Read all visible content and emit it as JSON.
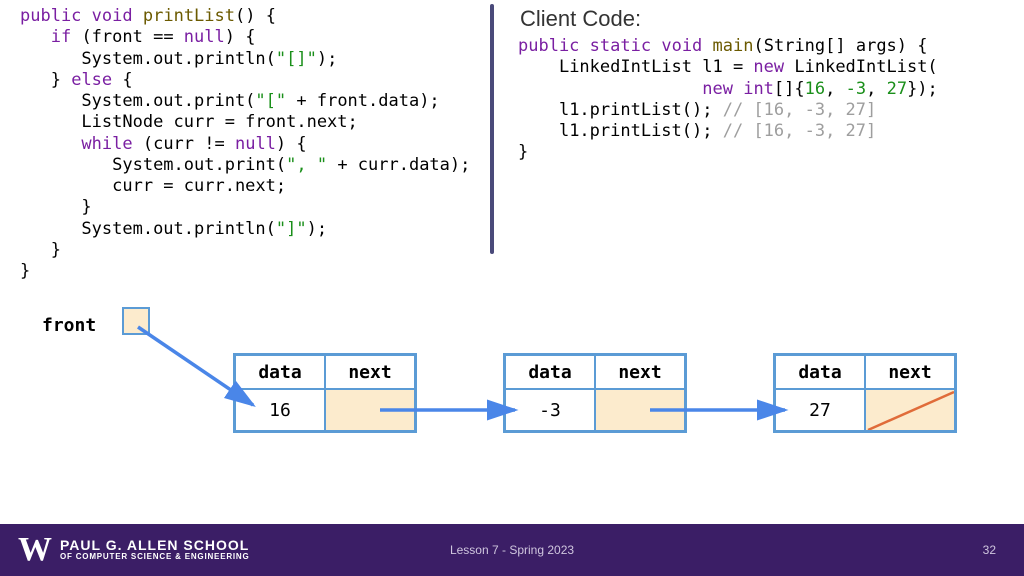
{
  "left_code": {
    "l1a": "public",
    "l1b": "void",
    "l1c": "printList",
    "l1d": "() {",
    "l2a": "if",
    "l2b": " (front == ",
    "l2c": "null",
    "l2d": ") {",
    "l3a": "System.out.println(",
    "l3b": "\"[]\"",
    "l3c": ");",
    "l4a": "} ",
    "l4b": "else",
    "l4c": " {",
    "l5a": "System.out.print(",
    "l5b": "\"[\"",
    "l5c": " + front.data);",
    "l6": "ListNode curr = front.next;",
    "l7a": "while",
    "l7b": " (curr != ",
    "l7c": "null",
    "l7d": ") {",
    "l8a": "System.out.print(",
    "l8b": "\", \"",
    "l8c": " + curr.data);",
    "l9": "curr = curr.next;",
    "l10": "}",
    "l11a": "System.out.println(",
    "l11b": "\"]\"",
    "l11c": ");",
    "l12": "}",
    "l13": "}"
  },
  "right": {
    "title": "Client Code:",
    "r1a": "public",
    "r1b": "static",
    "r1c": "void",
    "r1d": "main",
    "r1e": "(String[] args) {",
    "r2a": "LinkedIntList l1 = ",
    "r2b": "new",
    "r2c": " LinkedIntList(",
    "r3a": "new",
    "r3b": "int",
    "r3c": "[]{",
    "r3d": "16",
    "r3e": ", ",
    "r3f": "-3",
    "r3g": ", ",
    "r3h": "27",
    "r3i": "});",
    "r4a": "l1.printList(); ",
    "r4b": "// [16, -3, 27]",
    "r5a": "l1.printList(); ",
    "r5b": "// [16, -3, 27]",
    "r6": "}"
  },
  "diagram": {
    "front": "front",
    "hdr_data": "data",
    "hdr_next": "next",
    "v1": "16",
    "v2": "-3",
    "v3": "27"
  },
  "footer": {
    "w": "W",
    "school1": "PAUL G. ALLEN SCHOOL",
    "school2": "OF COMPUTER SCIENCE & ENGINEERING",
    "lesson": "Lesson 7 - Spring 2023",
    "page": "32"
  }
}
